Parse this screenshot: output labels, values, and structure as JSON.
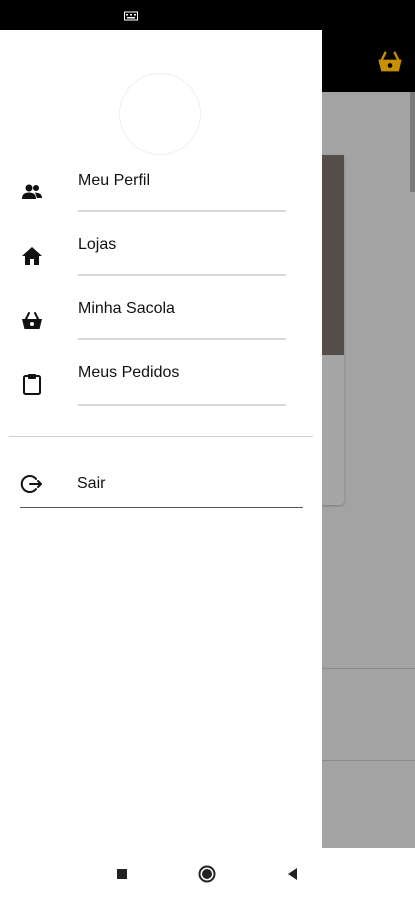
{
  "status_bar": {
    "icon": "keyboard-icon"
  },
  "app": {
    "cart_icon": "basket-icon",
    "accent_color": "#e0a800"
  },
  "drawer": {
    "avatar": "avatar",
    "items": [
      {
        "label": "Meu Perfil",
        "icon": "people-icon"
      },
      {
        "label": "Lojas",
        "icon": "home-icon"
      },
      {
        "label": "Minha Sacola",
        "icon": "basket-icon"
      },
      {
        "label": "Meus Pedidos",
        "icon": "clipboard-icon"
      }
    ],
    "logout": {
      "label": "Sair",
      "icon": "logout-icon"
    }
  },
  "nav_bar": {
    "recents": "square-icon",
    "home": "circle-icon",
    "back": "triangle-back-icon"
  }
}
